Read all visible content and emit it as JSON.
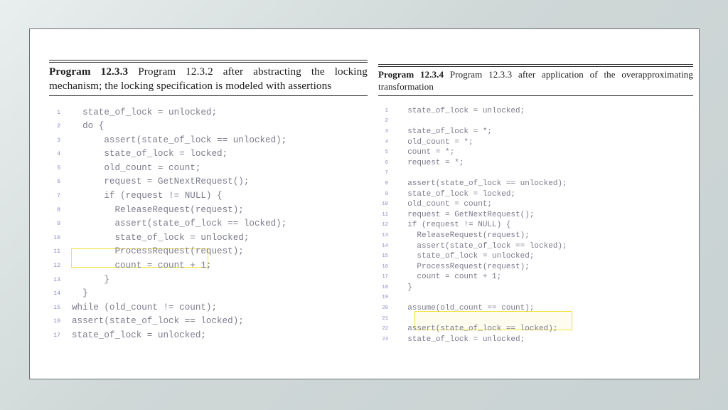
{
  "slide": {
    "background_color": "#ccd4d4",
    "canvas_color": "#ffffff",
    "border_color": "#6e7272"
  },
  "left_panel": {
    "caption": {
      "label": "Program 12.3.3",
      "body": " Program 12.3.2 after abstracting the locking mechanism; the locking specification is modeled with assertions"
    },
    "code": {
      "language": "c",
      "line_number_color": "#8b8bc8",
      "text_color": "#7c7c8e",
      "lines": [
        {
          "n": "1",
          "text": "  state_of_lock = unlocked;"
        },
        {
          "n": "2",
          "text": "  do {"
        },
        {
          "n": "3",
          "text": "      assert(state_of_lock == unlocked);"
        },
        {
          "n": "4",
          "text": "      state_of_lock = locked;"
        },
        {
          "n": "5",
          "text": "      old_count = count;"
        },
        {
          "n": "6",
          "text": "      request = GetNextRequest();"
        },
        {
          "n": "7",
          "text": "      if (request != NULL) {"
        },
        {
          "n": "8",
          "text": "        ReleaseRequest(request);"
        },
        {
          "n": "9",
          "text": "        assert(state_of_lock == locked);"
        },
        {
          "n": "10",
          "text": "        state_of_lock = unlocked;"
        },
        {
          "n": "11",
          "text": "        ProcessRequest(request);"
        },
        {
          "n": "12",
          "text": "        count = count + 1;"
        },
        {
          "n": "13",
          "text": "      }"
        },
        {
          "n": "14",
          "text": "  }"
        },
        {
          "n": "15",
          "text": "while (old_count != count);"
        },
        {
          "n": "16",
          "text": "assert(state_of_lock == locked);"
        },
        {
          "n": "17",
          "text": "state_of_lock = unlocked;"
        }
      ]
    },
    "highlight": {
      "line_number": "15",
      "text": "while (old_count != count);",
      "border_color": "#f2e23c",
      "fill_color": "transparent"
    }
  },
  "right_panel": {
    "caption": {
      "label": "Program 12.3.4",
      "body": " Program 12.3.3 after application of the overapproximating transformation"
    },
    "code": {
      "language": "c",
      "line_number_color": "#8b8bc8",
      "text_color": "#7c7c8e",
      "lines": [
        {
          "n": "1",
          "text": "  state_of_lock = unlocked;"
        },
        {
          "n": "2",
          "text": ""
        },
        {
          "n": "3",
          "text": "  state_of_lock = *;"
        },
        {
          "n": "4",
          "text": "  old_count = *;"
        },
        {
          "n": "5",
          "text": "  count = *;"
        },
        {
          "n": "6",
          "text": "  request = *;"
        },
        {
          "n": "7",
          "text": ""
        },
        {
          "n": "8",
          "text": "  assert(state_of_lock == unlocked);"
        },
        {
          "n": "9",
          "text": "  state_of_lock = locked;"
        },
        {
          "n": "10",
          "text": "  old_count = count;"
        },
        {
          "n": "11",
          "text": "  request = GetNextRequest();"
        },
        {
          "n": "12",
          "text": "  if (request != NULL) {"
        },
        {
          "n": "13",
          "text": "    ReleaseRequest(request);"
        },
        {
          "n": "14",
          "text": "    assert(state_of_lock == locked);"
        },
        {
          "n": "15",
          "text": "    state_of_lock = unlocked;"
        },
        {
          "n": "16",
          "text": "    ProcessRequest(request);"
        },
        {
          "n": "17",
          "text": "    count = count + 1;"
        },
        {
          "n": "18",
          "text": "  }"
        },
        {
          "n": "19",
          "text": ""
        },
        {
          "n": "20",
          "text": "  assume(old_count == count);"
        },
        {
          "n": "21",
          "text": ""
        },
        {
          "n": "22",
          "text": "  assert(state_of_lock == locked);"
        },
        {
          "n": "23",
          "text": "  state_of_lock = unlocked;"
        }
      ]
    },
    "highlight": {
      "line_number": "20",
      "text": "assume(old_count == count);",
      "border_color": "#f2e23c",
      "fill_color": "#fdfcef"
    }
  }
}
